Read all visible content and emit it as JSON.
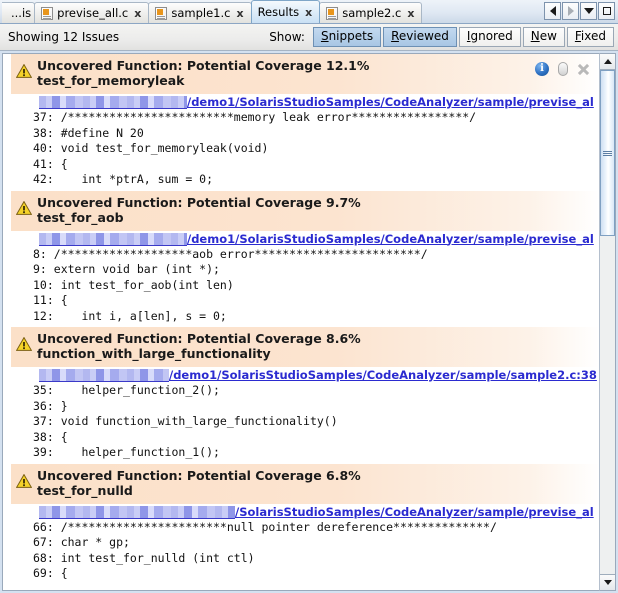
{
  "tabs": {
    "items": [
      {
        "label": "...is",
        "icon": "",
        "closable": false,
        "active": false,
        "truncated": true
      },
      {
        "label": "previse_all.c",
        "icon": "c-file-icon",
        "closable": true,
        "active": false,
        "truncated": false
      },
      {
        "label": "sample1.c",
        "icon": "c-file-icon",
        "closable": true,
        "active": false,
        "truncated": false
      },
      {
        "label": "Results",
        "icon": "",
        "closable": true,
        "active": true,
        "truncated": false
      },
      {
        "label": "sample2.c",
        "icon": "c-file-icon",
        "closable": true,
        "active": false,
        "truncated": false
      }
    ],
    "close_glyph": "x",
    "controls": [
      {
        "name": "scroll-tabs-left-button",
        "glyph": "left-arrow-icon"
      },
      {
        "name": "scroll-tabs-right-button",
        "glyph": "right-arrow-icon"
      },
      {
        "name": "tab-list-dropdown-button",
        "glyph": "chevron-down-icon"
      },
      {
        "name": "maximize-window-button",
        "glyph": "maximize-icon"
      }
    ]
  },
  "toolbar": {
    "status": "Showing 12 Issues",
    "show_label": "Show:",
    "filters": [
      {
        "label": "Snippets",
        "mnemonic": "S",
        "rest": "nippets",
        "selected": true
      },
      {
        "label": "Reviewed",
        "mnemonic": "R",
        "rest": "eviewed",
        "selected": true
      },
      {
        "label": "Ignored",
        "mnemonic": "I",
        "rest": "gnored",
        "selected": false
      },
      {
        "label": "New",
        "mnemonic": "N",
        "rest": "ew",
        "selected": false
      },
      {
        "label": "Fixed",
        "mnemonic": "F",
        "rest": "ixed",
        "selected": false
      }
    ]
  },
  "issues": [
    {
      "title": "Uncovered Function: Potential Coverage 12.1%",
      "function": "test_for_memoryleak",
      "redacted_width": 148,
      "path": "/demo1/SolarisStudioSamples/CodeAnalyzer/sample/previse_al",
      "actions": {
        "info": "i",
        "info_name": "issue-info-icon",
        "pill_name": "issue-note-icon",
        "close_name": "issue-dismiss-icon"
      },
      "code": [
        "37: /************************memory leak error*****************/",
        "38: #define N 20",
        "40: void test_for_memoryleak(void)",
        "41: {",
        "42:    int *ptrA, sum = 0;"
      ]
    },
    {
      "title": "Uncovered Function: Potential Coverage 9.7%",
      "function": "test_for_aob",
      "redacted_width": 148,
      "path": "/demo1/SolarisStudioSamples/CodeAnalyzer/sample/previse_al",
      "actions": null,
      "code": [
        "8: /*******************aob error************************/",
        "9: extern void bar (int *);",
        "10: int test_for_aob(int len)",
        "11: {",
        "12:    int i, a[len], s = 0;"
      ]
    },
    {
      "title": "Uncovered Function: Potential Coverage 8.6%",
      "function": "function_with_large_functionality",
      "redacted_width": 130,
      "path": "/demo1/SolarisStudioSamples/CodeAnalyzer/sample/sample2.c:38",
      "actions": null,
      "code": [
        "35:    helper_function_2();",
        "36: }",
        "37: void function_with_large_functionality()",
        "38: {",
        "39:    helper_function_1();"
      ]
    },
    {
      "title": "Uncovered Function: Potential Coverage 6.8%",
      "function": "test_for_nulld",
      "redacted_width": 196,
      "path": "/SolarisStudioSamples/CodeAnalyzer/sample/previse_al",
      "actions": null,
      "code": [
        "66: /***********************null pointer dereference**************/",
        "67: char * gp;",
        "68: int test_for_nulld (int ctl)",
        "69: {"
      ]
    }
  ],
  "scrollbar": {
    "up_glyph": "triangle-up-icon",
    "down_glyph": "triangle-down-icon",
    "thumb_top_pct": 0,
    "thumb_height_pct": 33
  }
}
